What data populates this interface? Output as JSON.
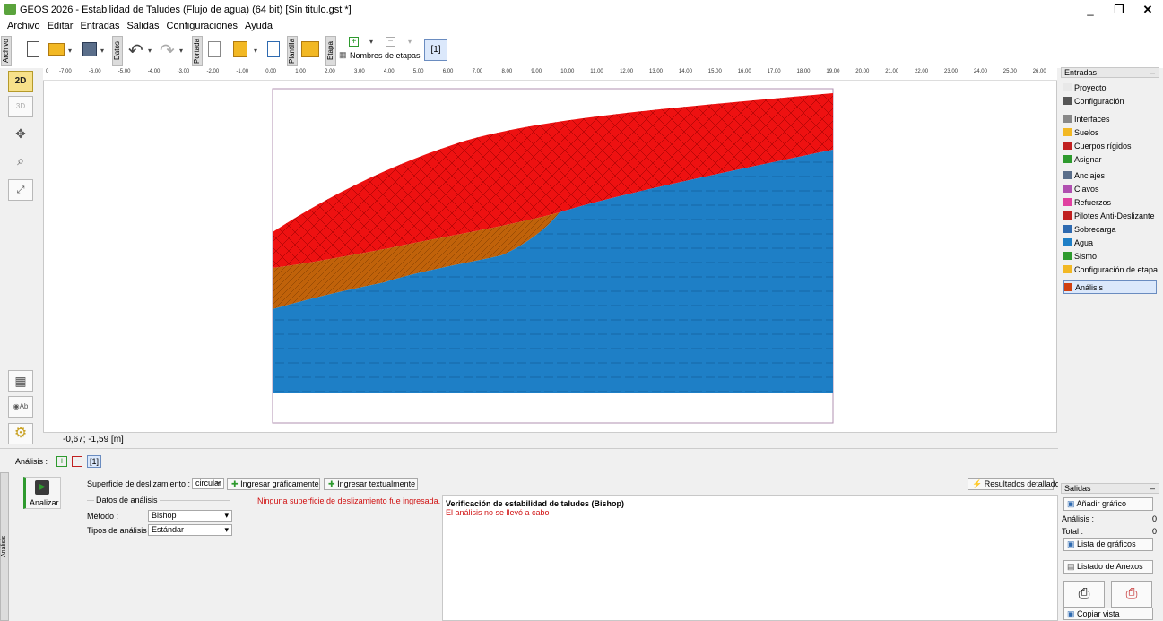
{
  "window": {
    "title": "GEOS 2026 - Estabilidad de Taludes (Flujo de agua) (64 bit) [Sin titulo.gst *]",
    "minimize": "_",
    "restore": "❐",
    "close": "✕"
  },
  "menu": [
    "Archivo",
    "Editar",
    "Entradas",
    "Salidas",
    "Configuraciones",
    "Ayuda"
  ],
  "toolbar": {
    "tabs": {
      "archivo": "Archivo",
      "datos": "Datos",
      "portada": "Portada",
      "plantilla": "Plantilla",
      "etapa": "Etapa"
    },
    "stage_names_label": "Nombres de etapas",
    "stage_current": "[1]"
  },
  "left_tools": {
    "mode_2d": "2D",
    "mode_3d": "3D"
  },
  "ruler": {
    "labels": [
      "-7,00",
      "-6,00",
      "-5,00",
      "-4,00",
      "-3,00",
      "-2,00",
      "-1,00",
      "0,00",
      "1,00",
      "2,00",
      "3,00",
      "4,00",
      "5,00",
      "6,00",
      "7,00",
      "8,00",
      "9,00",
      "10,00",
      "11,00",
      "12,00",
      "13,00",
      "14,00",
      "15,00",
      "16,00",
      "17,00",
      "18,00",
      "19,00",
      "20,00",
      "21,00",
      "22,00",
      "23,00",
      "24,00",
      "25,00",
      "26,00"
    ],
    "unit": "[m]",
    "zero": "0"
  },
  "coordinates": "-0,67; -1,59 [m]",
  "colors": {
    "red_layer": "#ee1111",
    "brown_layer": "#c0620a",
    "blue_layer": "#1e7fc6",
    "accent": "#2e9a2e"
  },
  "entradas": {
    "title": "Entradas",
    "items": [
      "Proyecto",
      "Configuración",
      "Interfaces",
      "Suelos",
      "Cuerpos rígidos",
      "Asignar",
      "Anclajes",
      "Clavos",
      "Refuerzos",
      "Pilotes Anti-Deslizante",
      "Sobrecarga",
      "Agua",
      "Sismo",
      "Configuración de etapa",
      "Análisis"
    ]
  },
  "bottom": {
    "tab_label": "Análisis",
    "analysis_label": "Análisis :",
    "stage": "[1]",
    "analyze_button": "Analizar",
    "slip_surface_label": "Superficie de deslizamiento :",
    "slip_surface_value": "circular",
    "input_graphic": "Ingresar gráficamente",
    "input_text": "Ingresar textualmente",
    "warning": "Ninguna superficie de deslizamiento fue ingresada.",
    "detailed_results": "Resultados detallados",
    "analysis_data_label": "Datos de análisis",
    "method_label": "Método :",
    "method_value": "Bishop",
    "analysis_type_label": "Tipos de análisis :",
    "analysis_type_value": "Estándar",
    "output_title": "Verificación de estabilidad de taludes (Bishop)",
    "output_message": "El análisis no se llevó a cabo"
  },
  "salidas": {
    "title": "Salidas",
    "add_graphic": "Añadir gráfico",
    "analysis_label": "Análisis :",
    "analysis_count": "0",
    "total_label": "Total :",
    "total_count": "0",
    "graphics_list": "Lista de gráficos",
    "annex_list": "Listado de Anexos",
    "copy_view": "Copiar vista"
  }
}
